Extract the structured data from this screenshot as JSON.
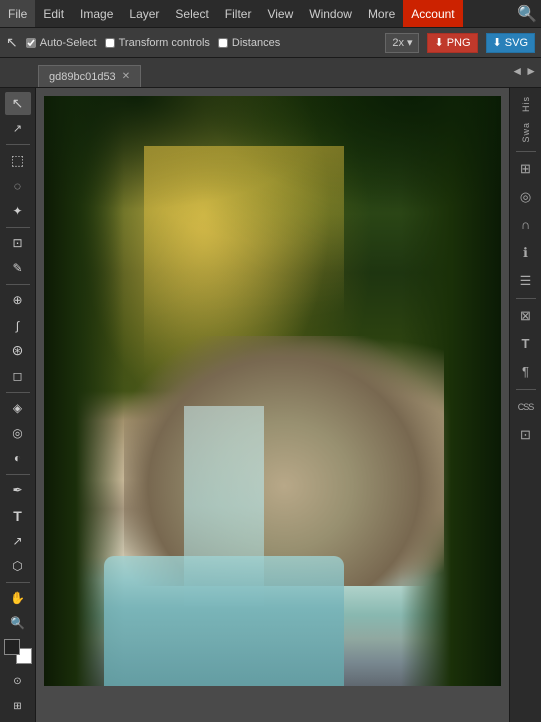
{
  "menubar": {
    "items": [
      {
        "label": "File",
        "id": "file"
      },
      {
        "label": "Edit",
        "id": "edit"
      },
      {
        "label": "Image",
        "id": "image"
      },
      {
        "label": "Layer",
        "id": "layer"
      },
      {
        "label": "Select",
        "id": "select"
      },
      {
        "label": "Filter",
        "id": "filter"
      },
      {
        "label": "View",
        "id": "view"
      },
      {
        "label": "Window",
        "id": "window"
      },
      {
        "label": "More",
        "id": "more"
      },
      {
        "label": "Account",
        "id": "account"
      }
    ]
  },
  "optionsbar": {
    "auto_select_label": "Auto-Select",
    "transform_label": "Transform controls",
    "distances_label": "Distances",
    "zoom_value": "2x",
    "png_label": "PNG",
    "svg_label": "SVG"
  },
  "tab": {
    "name": "gd89bc01d53"
  },
  "tools": {
    "move": "↖",
    "select_rect": "⬚",
    "lasso": "◌",
    "magic_wand": "✦",
    "crop": "⊡",
    "eyedropper": "✎",
    "heal": "⊕",
    "brush": "🖌",
    "clone": "⊛",
    "eraser": "◻",
    "gradient": "◈",
    "blur": "◎",
    "dodge": "◐",
    "pen": "✒",
    "text": "T",
    "path_select": "↖",
    "shape": "⬡",
    "hand": "✋",
    "zoom": "🔍"
  },
  "right_panel": {
    "history_label": "His",
    "swatches_label": "Swa",
    "panels": [
      {
        "id": "layers-icon",
        "symbol": "⊞"
      },
      {
        "id": "adjustments-icon",
        "symbol": "◎"
      },
      {
        "id": "curves-icon",
        "symbol": "∩"
      },
      {
        "id": "info-icon",
        "symbol": "ℹ"
      },
      {
        "id": "align-icon",
        "symbol": "☰"
      },
      {
        "id": "transform-icon",
        "symbol": "⊠"
      },
      {
        "id": "text-icon",
        "symbol": "T"
      },
      {
        "id": "paragraph-icon",
        "symbol": "¶"
      },
      {
        "id": "css-label",
        "symbol": "CSS"
      },
      {
        "id": "image-icon",
        "symbol": "⊡"
      }
    ]
  },
  "colors": {
    "foreground": "#222222",
    "background": "#ffffff",
    "accent_red": "#cc2200",
    "accent_blue": "#2980b9"
  }
}
